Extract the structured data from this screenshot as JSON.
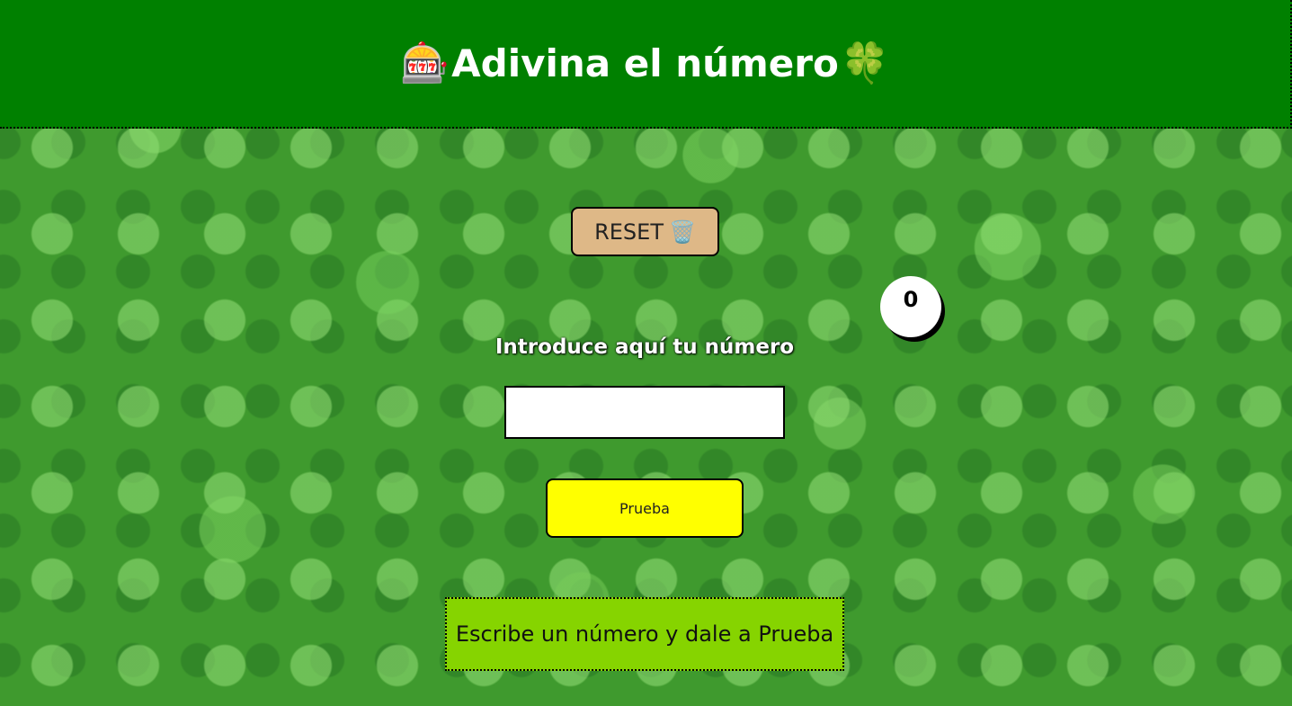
{
  "header": {
    "title": "Adivina el número",
    "left_emoji": "🎰",
    "right_emoji": "🍀",
    "background_color": "#008000"
  },
  "reset_button": {
    "label": "RESET",
    "icon_emoji": "🗑️",
    "background_color": "#deb887"
  },
  "score_counter": {
    "value": "0"
  },
  "guess_form": {
    "label": "Introduce aquí tu número",
    "input_value": "",
    "submit_label": "Prueba",
    "submit_color": "#ffff00"
  },
  "message_box": {
    "text": "Escribe un número y dale a Prueba",
    "background_color": "#86d400"
  }
}
